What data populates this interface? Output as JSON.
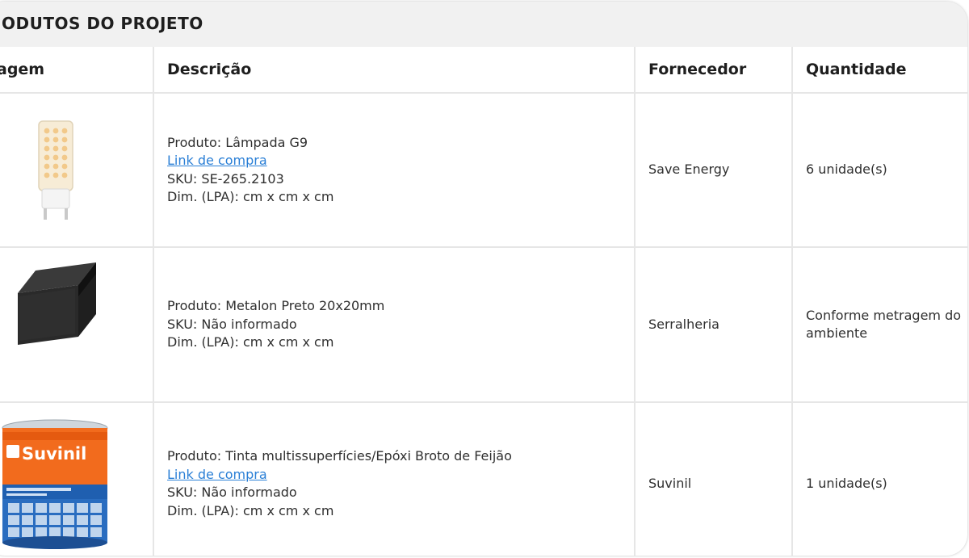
{
  "panel": {
    "title": "ODUTOS DO PROJETO"
  },
  "table": {
    "headers": [
      "agem",
      "Descrição",
      "Fornecedor",
      "Quantidade"
    ],
    "rows": [
      {
        "image_icon": "g9-lamp-image",
        "product": "Produto: Lâmpada G9",
        "link": "Link de compra",
        "sku": "SKU: SE-265.2103",
        "dims": "Dim. (LPA): cm x cm x cm",
        "supplier": "Save Energy",
        "quantity": "6 unidade(s)"
      },
      {
        "image_icon": "black-metalon-tube-image",
        "product": "Produto: Metalon Preto 20x20mm",
        "sku": "SKU: Não informado",
        "dims": "Dim. (LPA): cm x cm x cm",
        "supplier": "Serralheria",
        "quantity": "Conforme metragem do ambiente"
      },
      {
        "image_icon": "suvinil-paint-can-image",
        "product": "Produto: Tinta multissuperfícies/Epóxi Broto de Feijão",
        "link": "Link de compra",
        "sku": "SKU: Não informado",
        "dims": "Dim. (LPA): cm x cm x cm",
        "supplier": "Suvinil",
        "quantity": "1 unidade(s)"
      }
    ]
  },
  "paint_can_brand": "Suvinil",
  "colors": {
    "link": "#2a7fd6",
    "header_bg": "#f1f1f1",
    "border": "#e6e6e6",
    "suvinil_orange": "#f26b1d",
    "suvinil_blue": "#1f5fb0"
  }
}
